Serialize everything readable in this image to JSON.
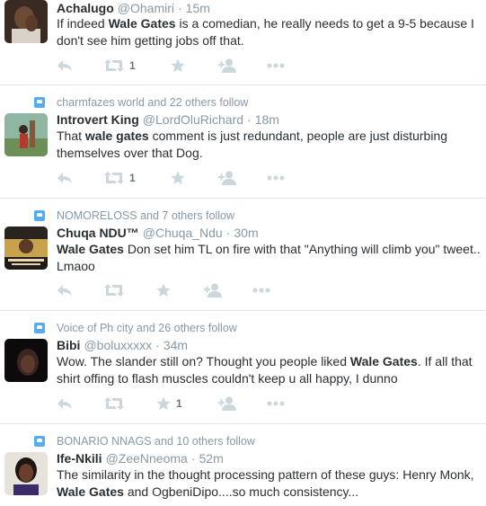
{
  "tweets": [
    {
      "context": "",
      "name": "Achalugo",
      "handle": "@Ohamiri",
      "time": "15m",
      "text_parts": [
        "If indeed ",
        "Wale Gates",
        " is a comedian, he really needs to get a 9-5 because I don't see him getting jobs off that."
      ],
      "retweet_count": "1",
      "favorite_count": "",
      "avatar": "man-hand-on-face-photo"
    },
    {
      "context": "charmfazes world and 22 others follow",
      "name": "Introvert King",
      "handle": "@LordOluRichard",
      "time": "18m",
      "text_parts": [
        "That ",
        "wale gates",
        " comment is just redundant, people are just disturbing themselves over that Dog."
      ],
      "retweet_count": "1",
      "favorite_count": "",
      "avatar": "man-outdoors-photo"
    },
    {
      "context": "NOMORELOSS and 7 others follow",
      "name": "Chuqa NDU™",
      "handle": "@Chuqa_Ndu",
      "time": "30m",
      "text_parts": [
        "",
        "Wale Gates",
        " Don set him TL on fire with that \"Anything will climb you\" tweet.. Lmaoo"
      ],
      "retweet_count": "",
      "favorite_count": "",
      "avatar": "excuse-me-dance-poster"
    },
    {
      "context": "Voice of Ph city and 26 others follow",
      "name": "Bibi",
      "handle": "@boluxxxxx",
      "time": "34m",
      "text_parts": [
        "Wow. The slander still on? Thought you people liked ",
        "Wale Gates",
        ". If all that shirt offing to flash muscles couldn't keep u all happy, I dunno"
      ],
      "retweet_count": "",
      "favorite_count": "1",
      "avatar": "dark-selfie-photo"
    },
    {
      "context": "BONARIO NNAGS and 10 others follow",
      "name": "Ife-Nkili",
      "handle": "@ZeeNneoma",
      "time": "52m",
      "text_parts": [
        "The similarity in the thought processing pattern of these guys: Henry Monk, ",
        "Wale Gates",
        " and OgbeniDipo....so much consistency..."
      ],
      "retweet_count": "",
      "favorite_count": "",
      "avatar": "woman-portrait-photo"
    }
  ],
  "colors": {
    "accent": "#55acee",
    "muted": "#8899a6",
    "icon": "#ccd6dd",
    "text": "#292f33"
  }
}
